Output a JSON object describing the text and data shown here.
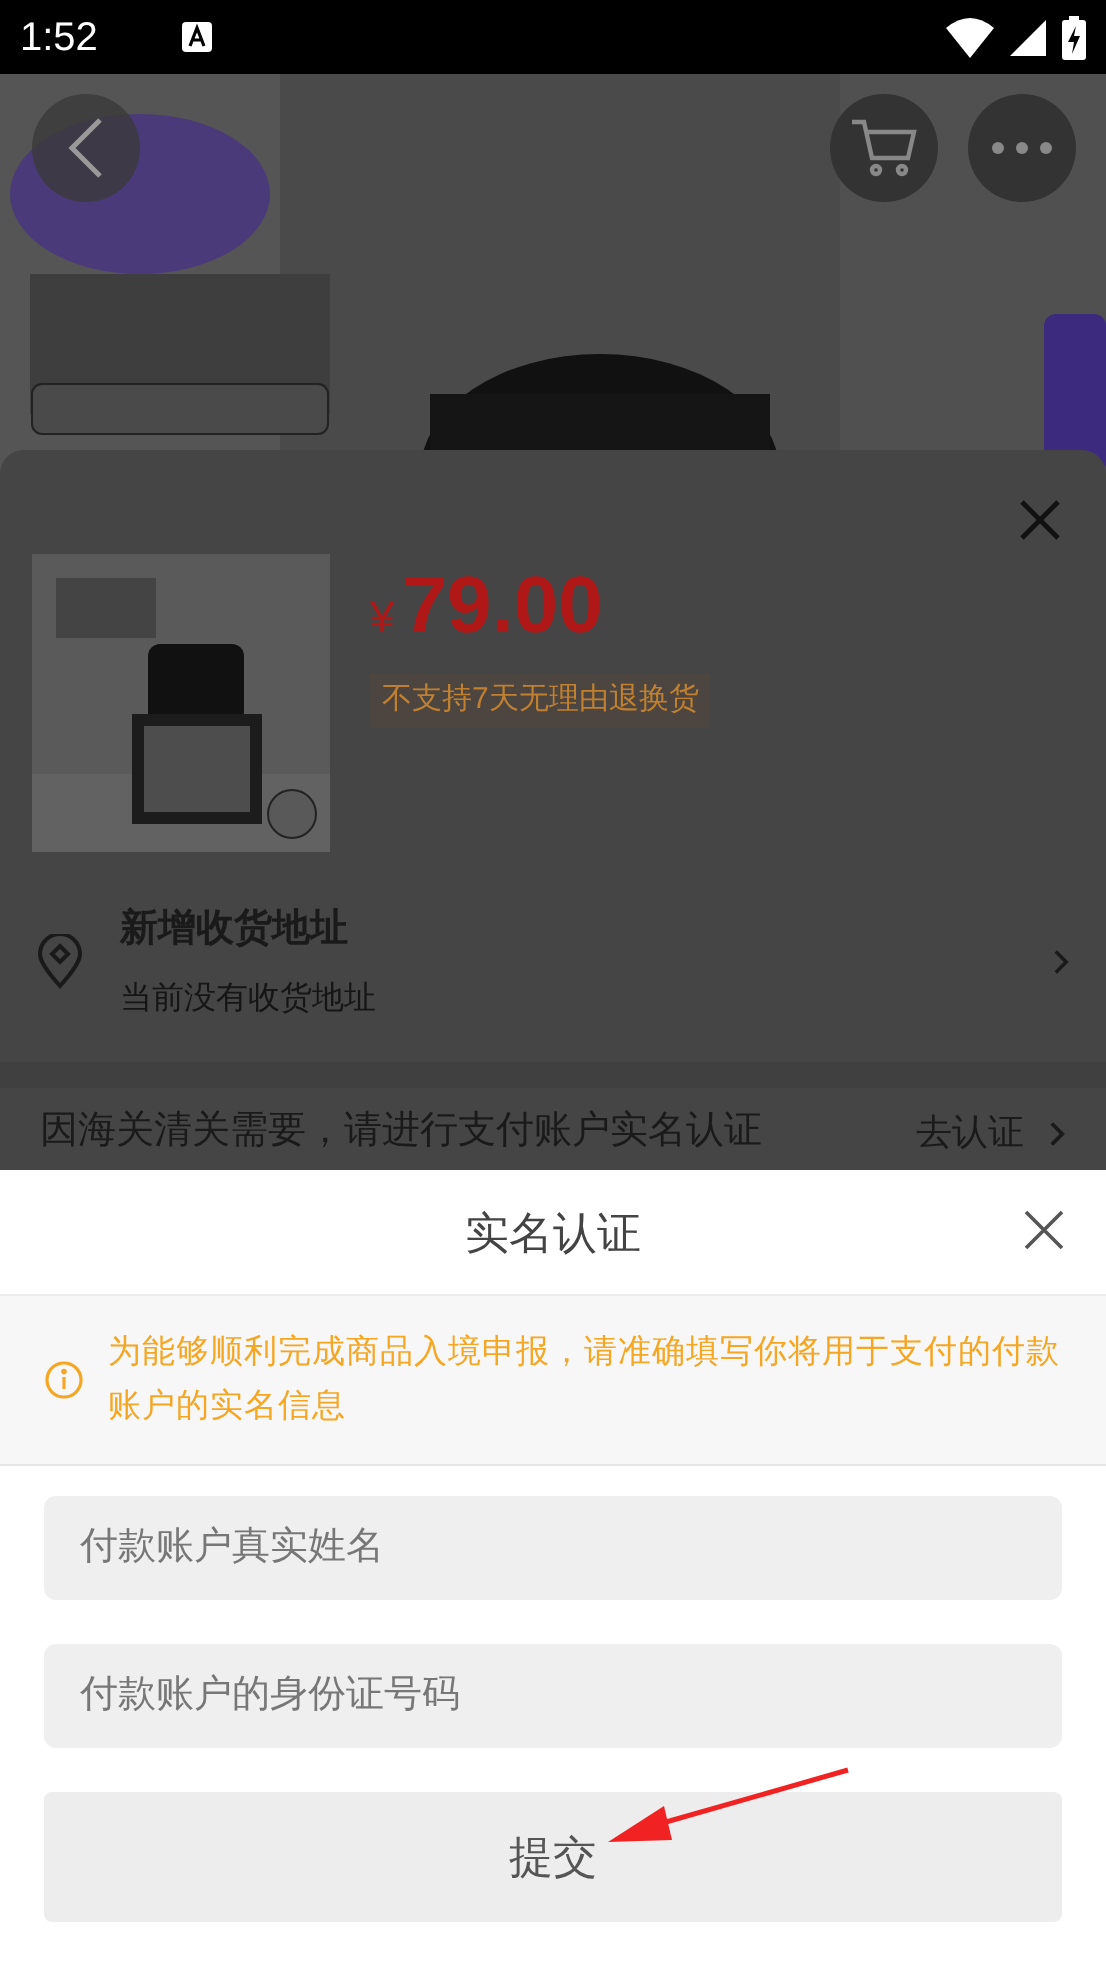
{
  "status_bar": {
    "time": "1:52"
  },
  "product_sheet": {
    "currency": "¥",
    "price": "79.00",
    "return_policy": "不支持7天无理由退换货",
    "address": {
      "title": "新增收货地址",
      "subtitle": "当前没有收货地址"
    },
    "verify_notice": {
      "text": "因海关清关需要，请进行支付账户实名认证",
      "action": "去认证"
    }
  },
  "dialog": {
    "title": "实名认证",
    "notice": "为能够顺利完成商品入境申报，请准确填写你将用于支付的付款账户的实名信息",
    "fields": [
      {
        "placeholder": "付款账户真实姓名"
      },
      {
        "placeholder": "付款账户的身份证号码"
      }
    ],
    "submit": "提交"
  }
}
